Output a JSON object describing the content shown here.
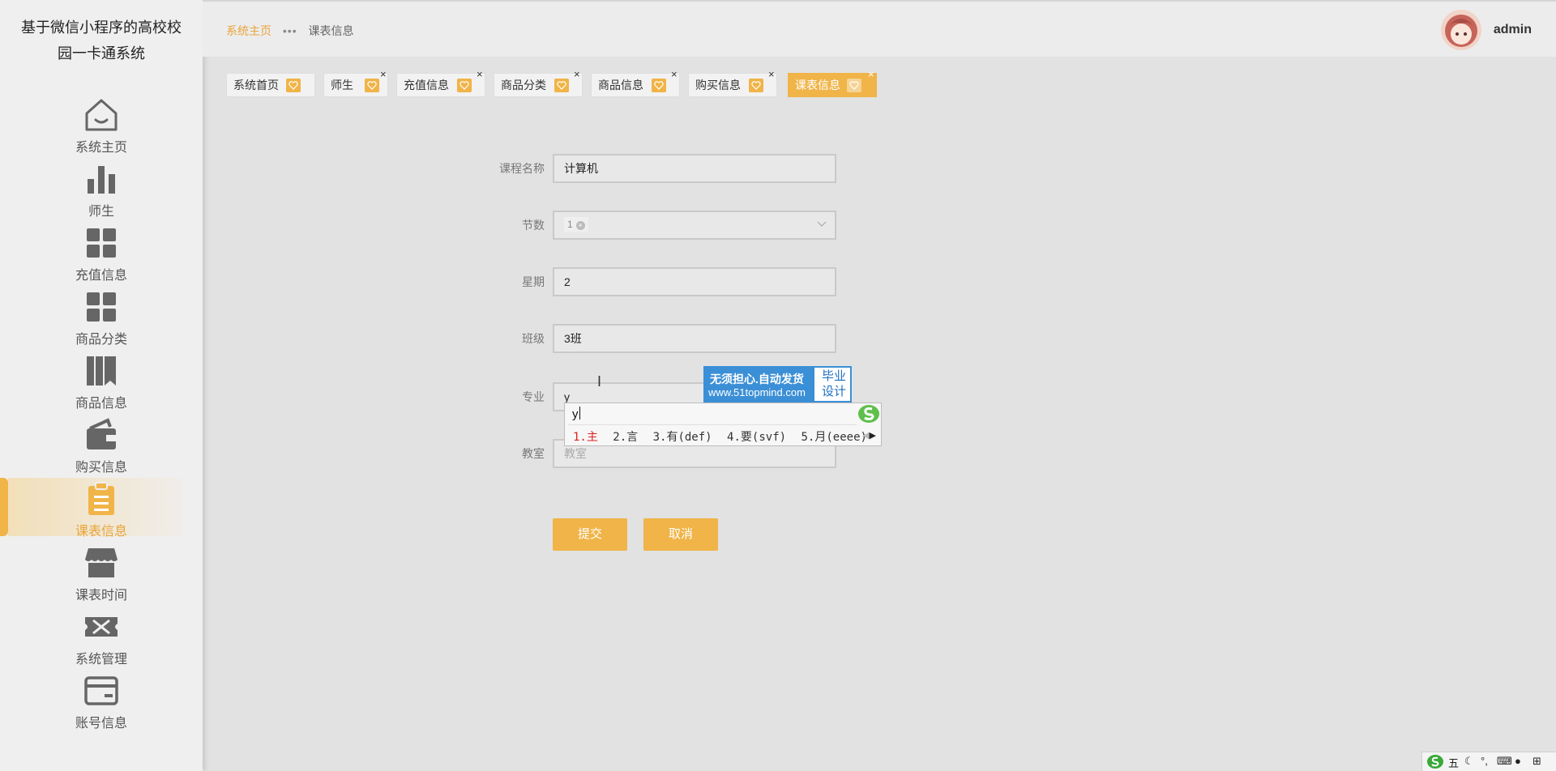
{
  "app": {
    "title_line1": "基于微信小程序的高校校",
    "title_line2": "园一卡通系统"
  },
  "sidebar": {
    "items": [
      {
        "label": "系统主页",
        "icon": "home-icon"
      },
      {
        "label": "师生",
        "icon": "bar-chart-icon"
      },
      {
        "label": "充值信息",
        "icon": "grid-icon"
      },
      {
        "label": "商品分类",
        "icon": "grid-icon"
      },
      {
        "label": "商品信息",
        "icon": "books-icon"
      },
      {
        "label": "购买信息",
        "icon": "wallet-icon"
      },
      {
        "label": "课表信息",
        "icon": "clipboard-icon",
        "active": true
      },
      {
        "label": "课表时间",
        "icon": "store-icon"
      },
      {
        "label": "系统管理",
        "icon": "ticket-icon"
      },
      {
        "label": "账号信息",
        "icon": "card-icon"
      }
    ]
  },
  "header": {
    "breadcrumb_home": "系统主页",
    "breadcrumb_sep": "•••",
    "breadcrumb_current": "课表信息",
    "username": "admin"
  },
  "tags": [
    {
      "label": "系统首页"
    },
    {
      "label": "师生"
    },
    {
      "label": "充值信息"
    },
    {
      "label": "商品分类"
    },
    {
      "label": "商品信息"
    },
    {
      "label": "购买信息"
    },
    {
      "label": "课表信息",
      "active": true
    }
  ],
  "tag_close": "×",
  "form": {
    "course_name_label": "课程名称",
    "course_name_value": "计算机",
    "period_label": "节数",
    "period_value": "1",
    "weekday_label": "星期",
    "weekday_value": "2",
    "class_label": "班级",
    "class_value": "3班",
    "major_label": "专业",
    "major_value": "y",
    "classroom_label": "教室",
    "classroom_placeholder": "教室",
    "submit_label": "提交",
    "cancel_label": "取消"
  },
  "watermark": {
    "line1": "无须担心.自动发货",
    "line2": "www.51topmind.com",
    "right1": "毕业",
    "right2": "设计"
  },
  "ime": {
    "composition": "y",
    "candidates": [
      "1.主",
      "2.言",
      "3.有(def)",
      "4.要(svf)",
      "5.月(eeee)"
    ]
  },
  "tray": {
    "mode": "五"
  },
  "colors": {
    "accent": "#f0b448",
    "accent_text": "#e9a53a",
    "watermark_blue": "#3b8fd6"
  }
}
